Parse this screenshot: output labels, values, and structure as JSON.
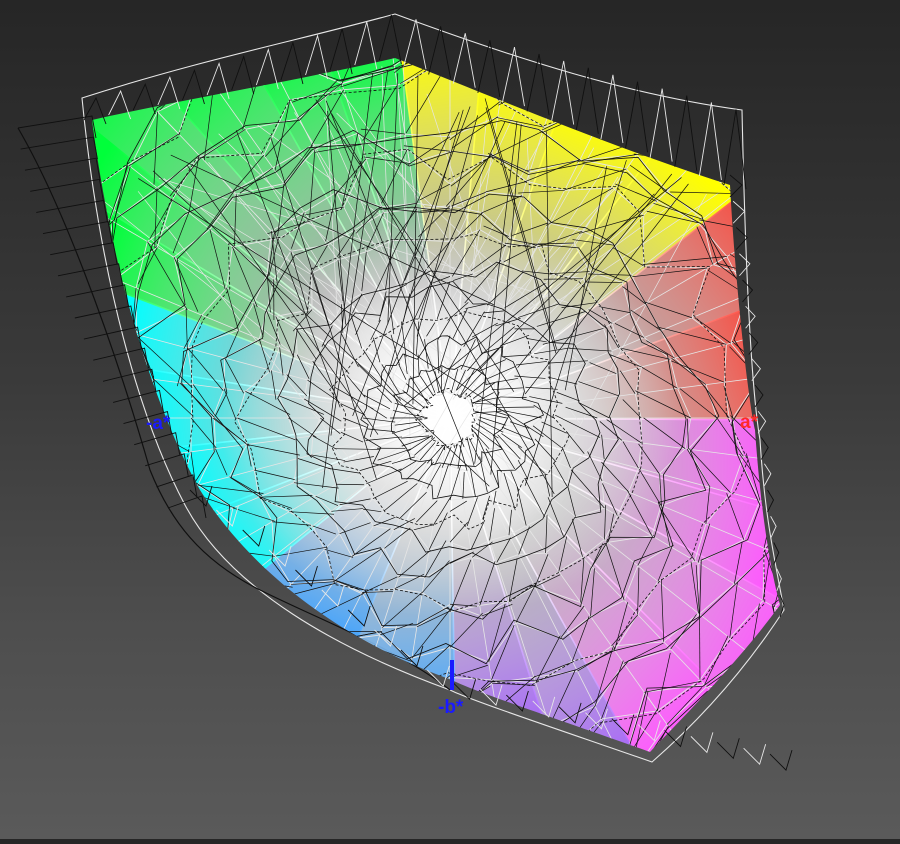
{
  "axes": {
    "neg_a": {
      "label": "-a*",
      "color": "#1a1aff"
    },
    "pos_a": {
      "label": "a*",
      "color": "#ff2a2a"
    },
    "neg_b": {
      "label": "-b*",
      "color": "#1a1aff"
    }
  },
  "gamut_colors": {
    "green": "#00ff3a",
    "yellow": "#ffff00",
    "red": "#ff3b2e",
    "cyan": "#00ffff",
    "blue": "#3aa0ff",
    "magenta": "#ff55ff",
    "violet": "#a055ff",
    "white_point": "#ffffff"
  },
  "wireframes": {
    "reference_color": "#e6e6e6",
    "measured_color": "#101010"
  }
}
